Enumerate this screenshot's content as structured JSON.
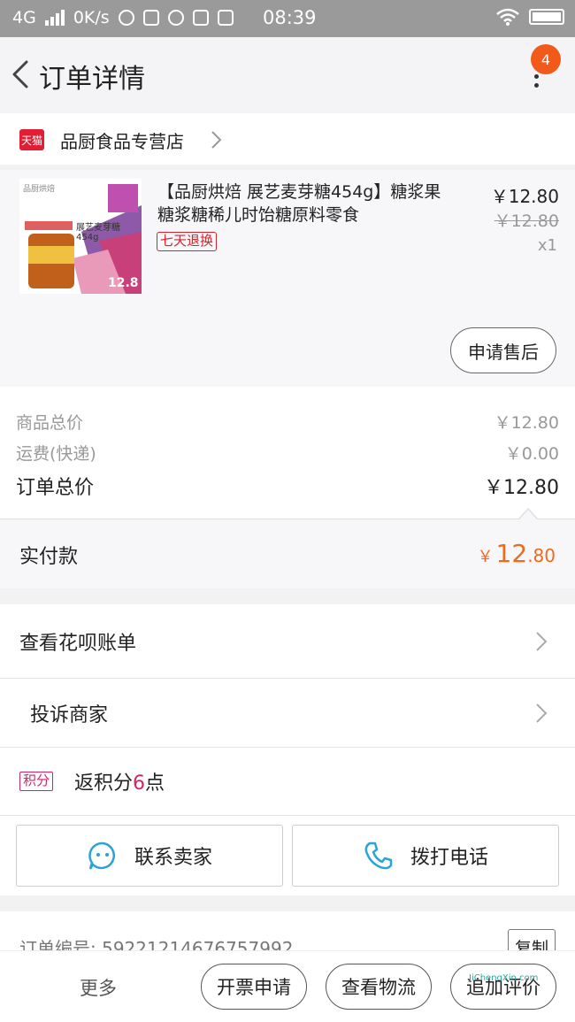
{
  "status_bar": {
    "network": "4G",
    "speed": "0K/s",
    "time": "08:39"
  },
  "nav": {
    "title": "订单详情",
    "badge_count": "4"
  },
  "shop": {
    "platform_tag": "天猫",
    "name": "品厨食品专营店"
  },
  "product": {
    "title": "【品厨烘焙 展艺麦芽糖454g】糖浆果糖浆糖稀儿时饴糖原料零食",
    "return_tag": "七天退换",
    "price": "￥12.80",
    "original_price": "￥12.80",
    "quantity": "x1",
    "thumb_brand": "品厨烘焙",
    "thumb_spec": "展艺麦芽糖454g",
    "thumb_price": "12.8",
    "after_sale_button": "申请售后"
  },
  "summary": {
    "goods_total_label": "商品总价",
    "goods_total_value": "￥12.80",
    "shipping_label": "运费(快递)",
    "shipping_value": "￥0.00",
    "order_total_label": "订单总价",
    "order_total_value": "￥12.80"
  },
  "paid": {
    "label": "实付款",
    "currency": "￥",
    "integer": "12",
    "decimal": ".80"
  },
  "list": {
    "huabei": "查看花呗账单",
    "complain": "投诉商家",
    "points_tag": "积分",
    "points_prefix": "返积分",
    "points_value": "6",
    "points_suffix": "点"
  },
  "actions": {
    "contact_seller": "联系卖家",
    "call": "拨打电话"
  },
  "order": {
    "number_text": "订单编号: 59221214676757992",
    "copy_button": "复制"
  },
  "bottom_bar": {
    "more": "更多",
    "invoice": "开票申请",
    "logistics": "查看物流",
    "add_review": "追加评价"
  },
  "watermark": "JiChengXin.com",
  "colors": {
    "accent_orange": "#ee6a1e",
    "badge": "#f25a1a",
    "tmall_red": "#e21e34",
    "points_pink": "#d22467",
    "icon_blue": "#2ba3d8"
  }
}
